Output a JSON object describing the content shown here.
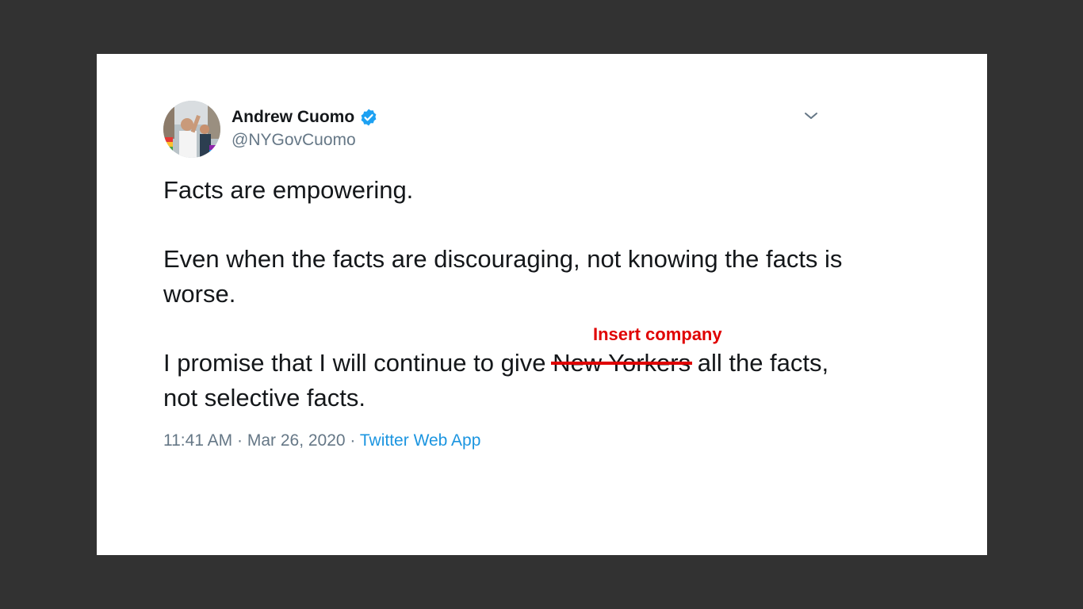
{
  "tweet": {
    "author_name": "Andrew Cuomo",
    "handle": "@NYGovCuomo",
    "verified": true,
    "paragraph1": "Facts are empowering.",
    "paragraph2": "Even when the facts are discouraging, not knowing the facts is worse.",
    "paragraph3_before": "I promise that I will continue to give ",
    "paragraph3_struck": "New Yorkers",
    "paragraph3_after": " all the facts, not selective facts.",
    "time": "11:41 AM",
    "separator": " · ",
    "date": "Mar 26, 2020",
    "source": "Twitter Web App"
  },
  "annotation": {
    "text": "Insert company",
    "color": "#e00000"
  },
  "icons": {
    "verified": "verified-badge-icon",
    "menu": "chevron-down-icon"
  },
  "colors": {
    "background": "#323232",
    "card": "#ffffff",
    "text": "#14171a",
    "secondary": "#657786",
    "link": "#1b95e0",
    "verified": "#1da1f2"
  }
}
